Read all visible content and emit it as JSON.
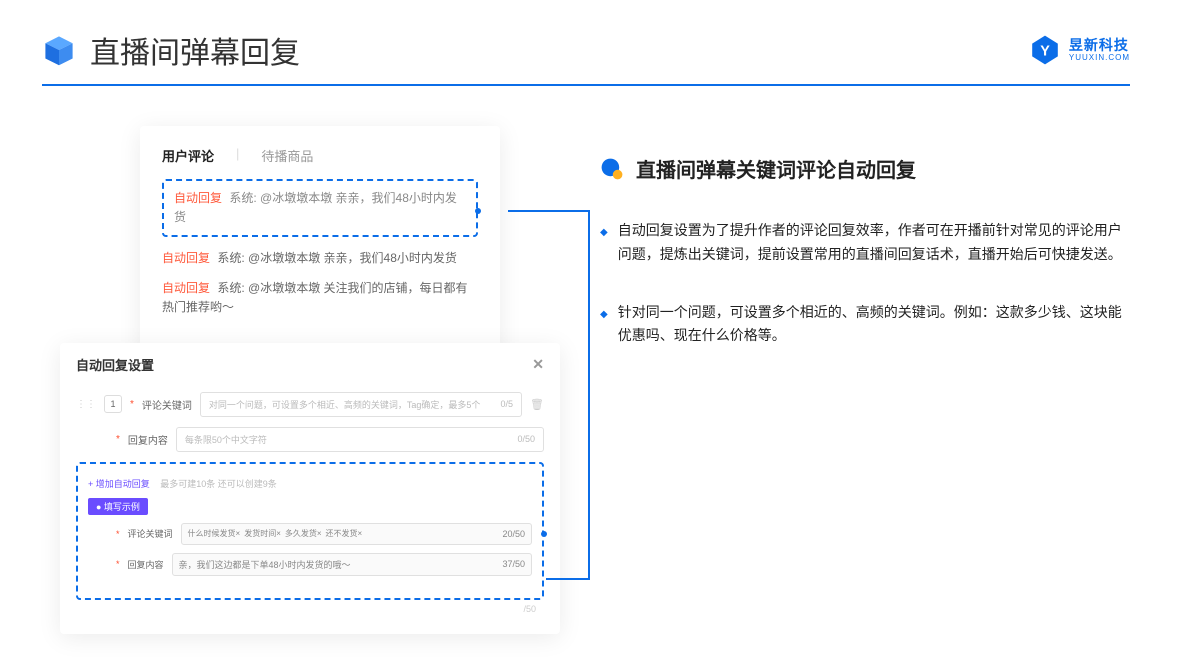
{
  "header": {
    "title": "直播间弹幕回复",
    "brand_cn": "昱新科技",
    "brand_en": "YUUXIN.COM"
  },
  "card_comments": {
    "tab_active": "用户评论",
    "tab_inactive": "待播商品",
    "highlighted": {
      "label": "自动回复",
      "text": "系统: @冰墩墩本墩 亲亲，我们48小时内发货"
    },
    "items": [
      {
        "label": "自动回复",
        "text": "系统: @冰墩墩本墩 亲亲，我们48小时内发货"
      },
      {
        "label": "自动回复",
        "text": "系统: @冰墩墩本墩 关注我们的店铺，每日都有热门推荐哟～"
      }
    ]
  },
  "settings": {
    "title": "自动回复设置",
    "index": "1",
    "keyword_label": "评论关键词",
    "keyword_placeholder": "对同一个问题，可设置多个相近、高频的关键词，Tag确定，最多5个",
    "keyword_counter": "0/5",
    "content_label": "回复内容",
    "content_placeholder": "每条限50个中文字符",
    "content_counter": "0/50",
    "add_link": "+ 增加自动回复",
    "add_hint": "最多可建10条 还可以创建9条",
    "example_badge": "● 填写示例",
    "ex_keyword_label": "评论关键词",
    "ex_tags": [
      "什么时候发货×",
      "发货时间×",
      "多久发货×",
      "还不发货×"
    ],
    "ex_keyword_counter": "20/50",
    "ex_content_label": "回复内容",
    "ex_content_value": "亲，我们这边都是下单48小时内发货的哦～",
    "ex_content_counter": "37/50",
    "below_counter": "/50"
  },
  "right": {
    "title": "直播间弹幕关键词评论自动回复",
    "bullets": [
      "自动回复设置为了提升作者的评论回复效率，作者可在开播前针对常见的评论用户问题，提炼出关键词，提前设置常用的直播间回复话术，直播开始后可快捷发送。",
      "针对同一个问题，可设置多个相近的、高频的关键词。例如：这款多少钱、这块能优惠吗、现在什么价格等。"
    ]
  }
}
